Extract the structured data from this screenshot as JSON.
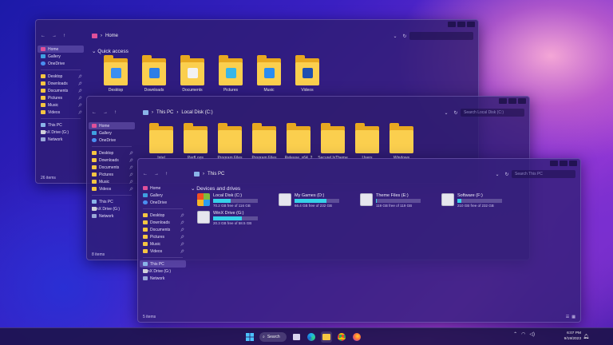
{
  "colors": {
    "accent": "#36d0e8",
    "folder": "#fbcf4e",
    "window_bg": "#2e1c6e"
  },
  "win1": {
    "address": [
      "Home"
    ],
    "section": "Quick access",
    "items": [
      {
        "label": "Desktop",
        "icon": "desktop-badge-icon",
        "badge": "#3a8ff0"
      },
      {
        "label": "Downloads",
        "icon": "download-badge-icon",
        "badge": "#2c7ee8"
      },
      {
        "label": "Documents",
        "icon": "document-badge-icon",
        "badge": "#f2f2f2"
      },
      {
        "label": "Pictures",
        "icon": "picture-badge-icon",
        "badge": "#38b6e8"
      },
      {
        "label": "Music",
        "icon": "music-badge-icon",
        "badge": "#2a8cf0"
      },
      {
        "label": "Videos",
        "icon": "video-badge-icon",
        "badge": "#1e4fb0"
      }
    ],
    "sidebar": [
      {
        "label": "Home",
        "icon": "home",
        "active": true
      },
      {
        "label": "Gallery",
        "icon": "gallery"
      },
      {
        "label": "OneDrive",
        "icon": "cloud"
      },
      {
        "sep": true
      },
      {
        "label": "Desktop",
        "icon": "folder",
        "pin": true
      },
      {
        "label": "Downloads",
        "icon": "folder",
        "pin": true
      },
      {
        "label": "Documents",
        "icon": "folder",
        "pin": true
      },
      {
        "label": "Pictures",
        "icon": "folder",
        "pin": true
      },
      {
        "label": "Music",
        "icon": "folder",
        "pin": true
      },
      {
        "label": "Videos",
        "icon": "folder",
        "pin": true
      },
      {
        "sep": true
      },
      {
        "label": "This PC",
        "icon": "pc"
      },
      {
        "label": "WinX Drive (G:)",
        "icon": "drive"
      },
      {
        "label": "Network",
        "icon": "net"
      }
    ],
    "status": "26 items"
  },
  "win2": {
    "address": [
      "This PC",
      "Local Disk (C:)"
    ],
    "search_placeholder": "Search Local Disk (C:)",
    "items": [
      "Intel",
      "PerfLogs",
      "Program Files",
      "Program Files",
      "Release_x64_2",
      "SecureUxTheme",
      "Users",
      "Windows"
    ],
    "sidebar": [
      {
        "label": "Home",
        "icon": "home",
        "active": true
      },
      {
        "label": "Gallery",
        "icon": "gallery"
      },
      {
        "label": "OneDrive",
        "icon": "cloud"
      },
      {
        "sep": true
      },
      {
        "label": "Desktop",
        "icon": "folder",
        "pin": true
      },
      {
        "label": "Downloads",
        "icon": "folder",
        "pin": true
      },
      {
        "label": "Documents",
        "icon": "folder",
        "pin": true
      },
      {
        "label": "Pictures",
        "icon": "folder",
        "pin": true
      },
      {
        "label": "Music",
        "icon": "folder",
        "pin": true
      },
      {
        "label": "Videos",
        "icon": "folder",
        "pin": true
      },
      {
        "sep": true
      },
      {
        "label": "This PC",
        "icon": "pc"
      },
      {
        "label": "WinX Drive (G:)",
        "icon": "drive"
      },
      {
        "label": "Network",
        "icon": "net"
      }
    ],
    "status": "8 items"
  },
  "win3": {
    "address": [
      "This PC"
    ],
    "search_placeholder": "Search This PC",
    "section": "Devices and drives",
    "drives": [
      {
        "name": "Local Disk (C:)",
        "free": "70.2 GB free of 116 GB",
        "used": 0.4,
        "icon": "windows-drive-icon"
      },
      {
        "name": "My Games (D:)",
        "free": "66.4 GB free of 232 GB",
        "used": 0.71,
        "icon": "drive-icon"
      },
      {
        "name": "Theme Files (E:)",
        "free": "119 GB free of 119 GB",
        "used": 0.02,
        "icon": "drive-icon"
      },
      {
        "name": "Software (F:)",
        "free": "210 GB free of 232 GB",
        "used": 0.09,
        "icon": "drive-icon"
      },
      {
        "name": "WinX Drive (G:)",
        "free": "20.3 GB free of 58.5 GB",
        "used": 0.65,
        "icon": "drive-icon"
      }
    ],
    "sidebar": [
      {
        "label": "Home",
        "icon": "home"
      },
      {
        "label": "Gallery",
        "icon": "gallery"
      },
      {
        "label": "OneDrive",
        "icon": "cloud"
      },
      {
        "sep": true
      },
      {
        "label": "Desktop",
        "icon": "folder",
        "pin": true
      },
      {
        "label": "Downloads",
        "icon": "folder",
        "pin": true
      },
      {
        "label": "Documents",
        "icon": "folder",
        "pin": true
      },
      {
        "label": "Pictures",
        "icon": "folder",
        "pin": true
      },
      {
        "label": "Music",
        "icon": "folder",
        "pin": true
      },
      {
        "label": "Videos",
        "icon": "folder",
        "pin": true
      },
      {
        "sep": true
      },
      {
        "label": "This PC",
        "icon": "pc",
        "active": true
      },
      {
        "label": "WinX Drive (G:)",
        "icon": "drive"
      },
      {
        "label": "Network",
        "icon": "net"
      }
    ],
    "status": "5 items"
  },
  "taskbar": {
    "search_label": "Search",
    "apps": [
      "windows-start-icon",
      "task-view-icon",
      "edge-icon",
      "file-explorer-icon",
      "chrome-icon",
      "firefox-icon"
    ],
    "time": "6:07 PM",
    "date": "9/19/2023"
  }
}
